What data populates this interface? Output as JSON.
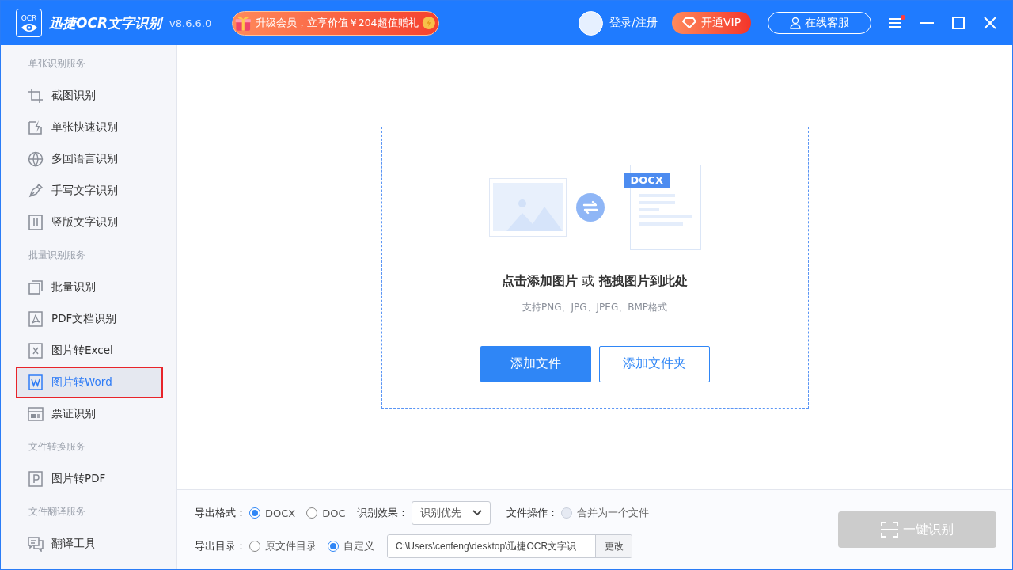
{
  "header": {
    "logo_text": "OCR",
    "app_name": "迅捷OCR文字识别",
    "version": "v8.6.6.0",
    "promo": "升级会员，立享价值￥204超值赠礼",
    "login": "登录/注册",
    "vip": "开通VIP",
    "service": "在线客服",
    "menu_notification": true
  },
  "sidebar": {
    "sections": [
      {
        "title": "单张识别服务",
        "items": [
          {
            "label": "截图识别",
            "kind": "crop",
            "selected": false
          },
          {
            "label": "单张快速识别",
            "kind": "quick",
            "selected": false
          },
          {
            "label": "多国语言识别",
            "kind": "globe",
            "selected": false
          },
          {
            "label": "手写文字识别",
            "kind": "pen",
            "selected": false
          },
          {
            "label": "竖版文字识别",
            "kind": "vertical",
            "selected": false
          }
        ]
      },
      {
        "title": "批量识别服务",
        "items": [
          {
            "label": "批量识别",
            "kind": "batch",
            "selected": false
          },
          {
            "label": "PDF文档识别",
            "kind": "pdf",
            "selected": false
          },
          {
            "label": "图片转Excel",
            "kind": "excel",
            "selected": false
          },
          {
            "label": "图片转Word",
            "kind": "word",
            "selected": true
          },
          {
            "label": "票证识别",
            "kind": "ticket",
            "selected": false
          }
        ]
      },
      {
        "title": "文件转换服务",
        "items": [
          {
            "label": "图片转PDF",
            "kind": "topdf",
            "selected": false
          }
        ]
      },
      {
        "title": "文件翻译服务",
        "items": [
          {
            "label": "翻译工具",
            "kind": "translate",
            "selected": false
          }
        ]
      }
    ]
  },
  "dropzone": {
    "badge": "DOCX",
    "title": "**点击添加图片** 或 **拖拽图片到此处**",
    "hint": "支持PNG、JPG、JPEG、BMP格式",
    "buttons": [
      {
        "label": "添加文件",
        "primary": true
      },
      {
        "label": "添加文件夹",
        "primary": false
      }
    ]
  },
  "options": {
    "format_label": "导出格式：",
    "formats": [
      {
        "label": "DOCX",
        "selected": true
      },
      {
        "label": "DOC",
        "selected": false
      }
    ],
    "effect_label": "识别效果：",
    "effect_value": "识别优先",
    "file_op_label": "文件操作：",
    "merge": {
      "label": "合并为一个文件",
      "checked": false,
      "disabled": true
    },
    "dir_label": "导出目录：",
    "dirs": [
      {
        "label": "原文件目录",
        "selected": false
      },
      {
        "label": "自定义",
        "selected": true
      }
    ],
    "path": "C:\\Users\\cenfeng\\desktop\\迅捷OCR文字识",
    "change": "更改",
    "run": {
      "label": "一键识别",
      "disabled": true
    }
  }
}
